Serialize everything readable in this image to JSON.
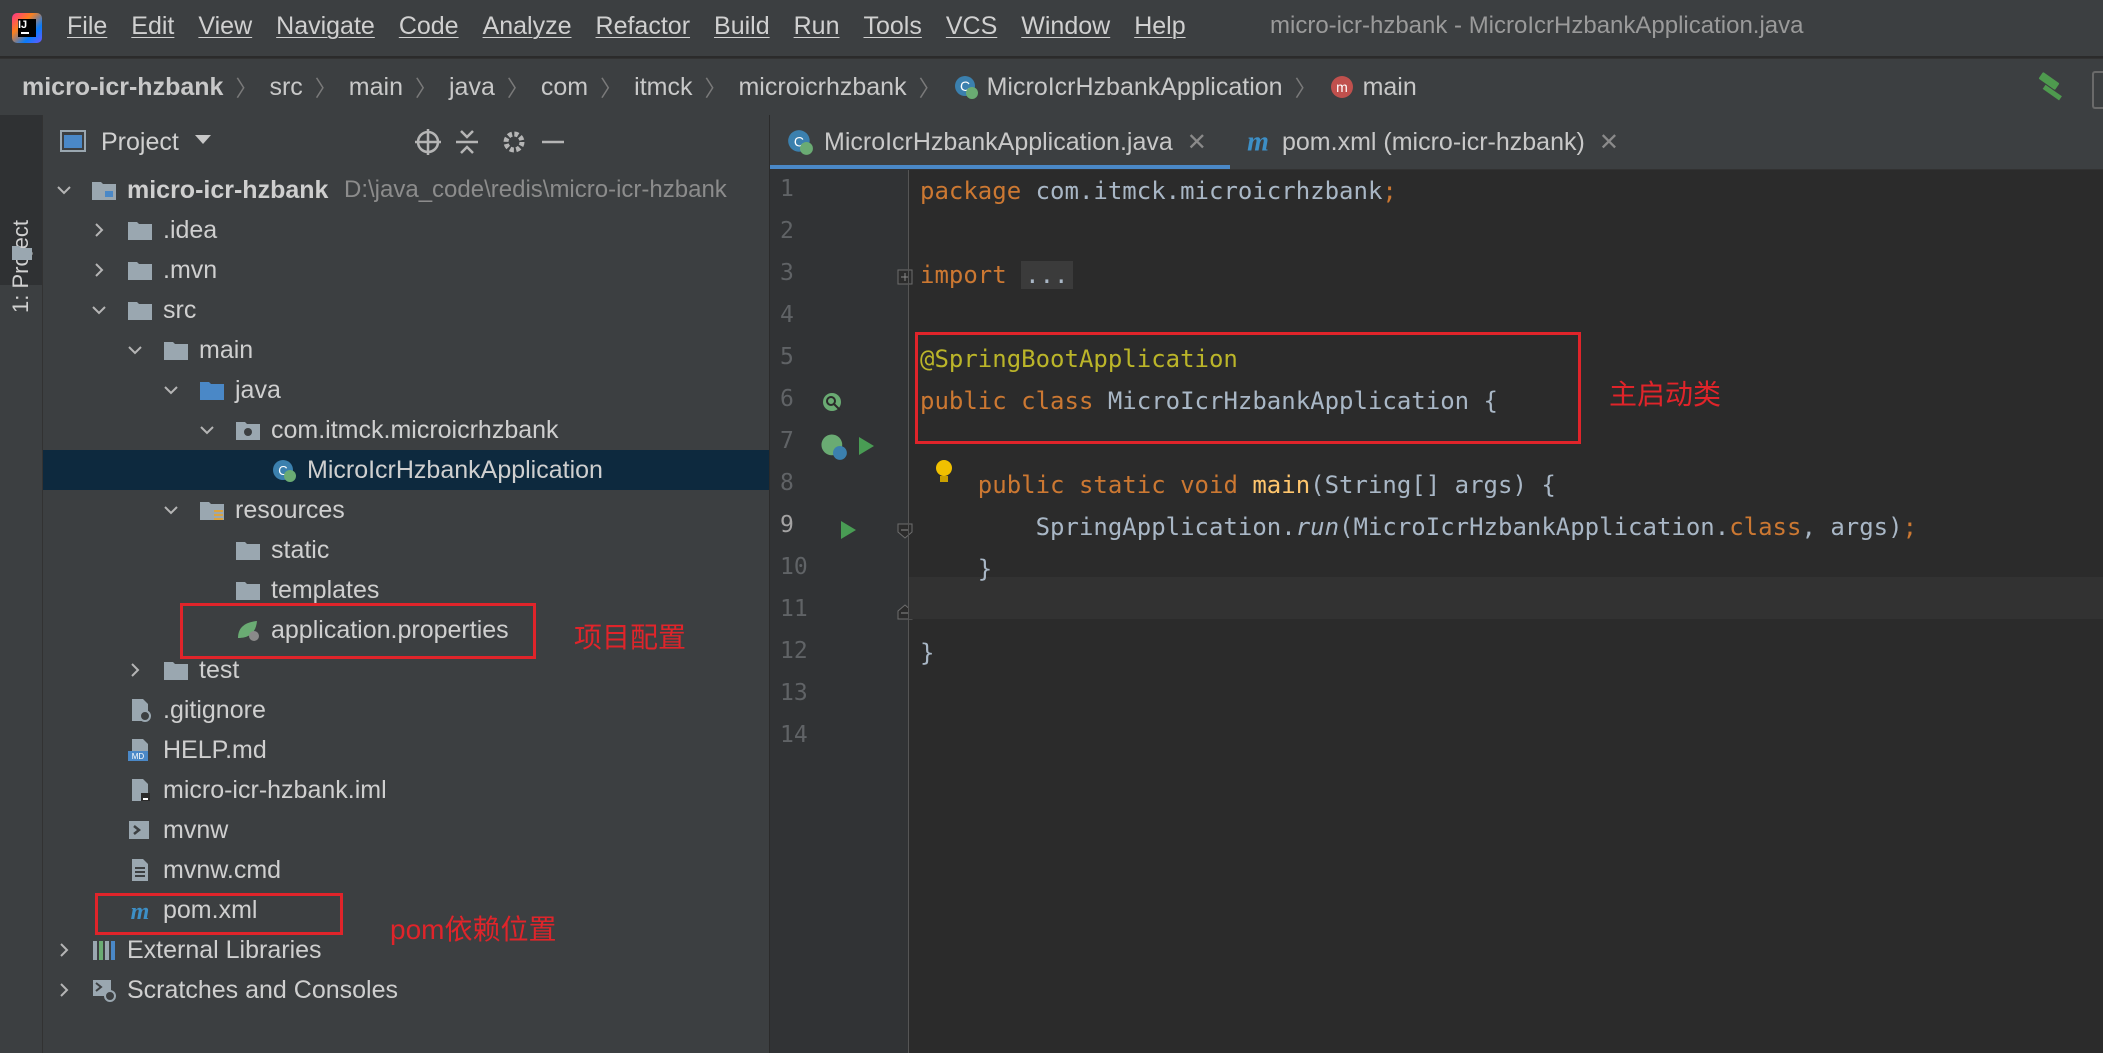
{
  "menubar": {
    "items": [
      "File",
      "Edit",
      "View",
      "Navigate",
      "Code",
      "Analyze",
      "Refactor",
      "Build",
      "Run",
      "Tools",
      "VCS",
      "Window",
      "Help"
    ],
    "window_title": "micro-icr-hzbank - MicroIcrHzbankApplication.java"
  },
  "breadcrumbs": [
    "micro-icr-hzbank",
    "src",
    "main",
    "java",
    "com",
    "itmck",
    "microicrhzbank",
    "MicroIcrHzbankApplication",
    "main"
  ],
  "left_stripe": {
    "label": "1: Project"
  },
  "project_panel": {
    "title": "Project",
    "tree": [
      {
        "label": "micro-icr-hzbank",
        "path": "D:\\java_code\\redis\\micro-icr-hzbank"
      },
      {
        "label": ".idea"
      },
      {
        "label": ".mvn"
      },
      {
        "label": "src"
      },
      {
        "label": "main"
      },
      {
        "label": "java"
      },
      {
        "label": "com.itmck.microicrhzbank"
      },
      {
        "label": "MicroIcrHzbankApplication"
      },
      {
        "label": "resources"
      },
      {
        "label": "static"
      },
      {
        "label": "templates"
      },
      {
        "label": "application.properties"
      },
      {
        "label": "test"
      },
      {
        "label": ".gitignore"
      },
      {
        "label": "HELP.md"
      },
      {
        "label": "micro-icr-hzbank.iml"
      },
      {
        "label": "mvnw"
      },
      {
        "label": "mvnw.cmd"
      },
      {
        "label": "pom.xml"
      },
      {
        "label": "External Libraries"
      },
      {
        "label": "Scratches and Consoles"
      }
    ]
  },
  "editor": {
    "tabs": [
      {
        "label": "MicroIcrHzbankApplication.java",
        "active": true
      },
      {
        "label": "pom.xml (micro-icr-hzbank)",
        "active": false
      }
    ],
    "line_numbers": [
      "1",
      "2",
      "3",
      "4",
      "5",
      "6",
      "7",
      "8",
      "9",
      "10",
      "11",
      "12",
      "13",
      "14"
    ],
    "code": {
      "l1_kw": "package",
      "l1_rest": " com.itmck.microicrhzbank",
      "l1_semi": ";",
      "l3_kw": "import",
      "l3_fold": "...",
      "l6_ann": "@SpringBootApplication",
      "l7_kw1": "public",
      "l7_kw2": "class",
      "l7_name": " MicroIcrHzbankApplication {",
      "l9_kw1": "public",
      "l9_kw2": "static",
      "l9_kw3": "void",
      "l9_fn": "main",
      "l9_rest": "(String[] args) {",
      "l10_a": "SpringApplication.",
      "l10_run": "run",
      "l10_b": "(MicroIcrHzbankApplication.",
      "l10_kw": "class",
      "l10_c": ", args)",
      "l10_semi": ";",
      "l11": "}",
      "l13": "}"
    }
  },
  "annotations": {
    "main_class_note": "主启动类",
    "config_note": "项目配置",
    "pom_note": "pom依赖位置"
  }
}
